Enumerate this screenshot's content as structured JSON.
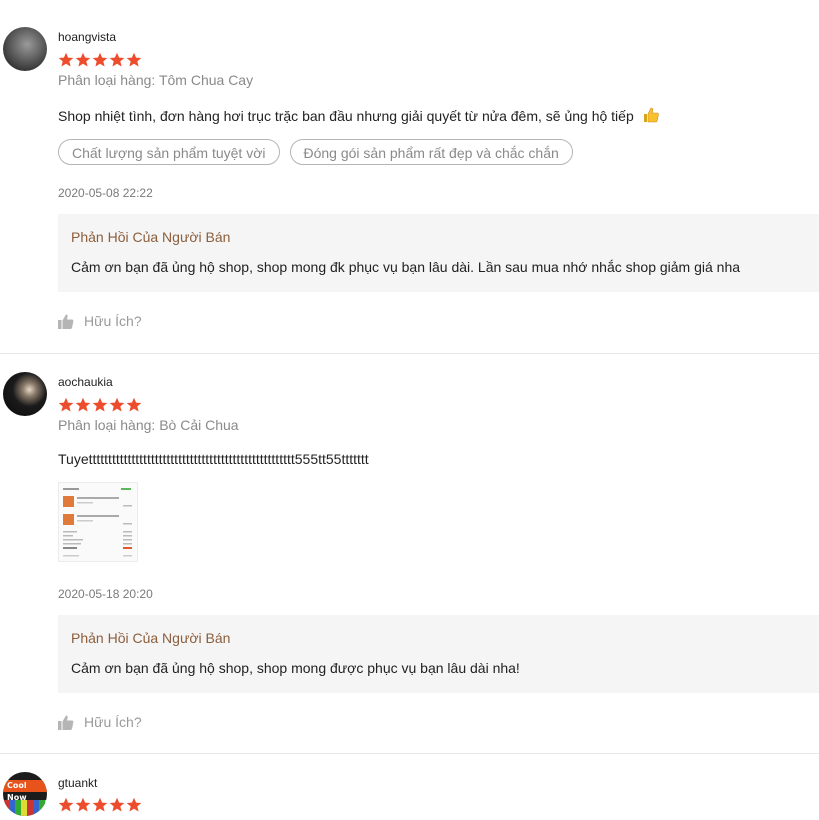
{
  "colors": {
    "star": "#ee4d2d",
    "seller_title": "#8b5e3c",
    "muted": "#8a8a8a"
  },
  "reviews": [
    {
      "username": "hoangvista",
      "rating": 5,
      "variation": "Phân loại hàng: Tôm Chua Cay",
      "comment": "Shop nhiệt tình, đơn hàng hơi trục trặc ban đầu nhưng giải quyết từ nửa đêm, sẽ ủng hộ tiếp",
      "comment_emoji": "thumbs-up-emoji",
      "tags": [
        "Chất lượng sản phẩm tuyệt vời",
        "Đóng gói sản phẩm rất đẹp và chắc chắn"
      ],
      "timestamp": "2020-05-08 22:22",
      "seller_reply": {
        "title": "Phản Hồi Của Người Bán",
        "text": "Cảm ơn bạn đã ủng hộ shop, shop mong đk phục vụ bạn lâu dài. Lần sau mua nhớ nhắc shop giảm giá nha"
      },
      "helpful_label": "Hữu Ích?"
    },
    {
      "username": "aochaukia",
      "rating": 5,
      "variation": "Phân loại hàng: Bò Cải Chua",
      "comment": "Tuyettttttttttttttttttttttttttttttttttttttttttttttttttttt555tt55ttttttt",
      "has_photo": true,
      "timestamp": "2020-05-18 20:20",
      "seller_reply": {
        "title": "Phản Hồi Của Người Bán",
        "text": "Cảm ơn bạn đã ủng hộ shop, shop mong  được phục vụ bạn lâu dài nha!"
      },
      "helpful_label": "Hữu Ích?"
    },
    {
      "username": "gtuankt",
      "rating": 5,
      "avatar_text": "Cool Now"
    }
  ]
}
